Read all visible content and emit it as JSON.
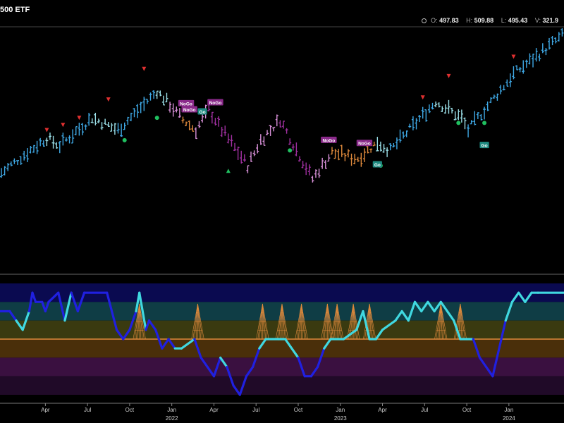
{
  "header": {
    "title": "500 ETF",
    "ohlc": [
      {
        "key": "O:",
        "value": "497.83"
      },
      {
        "key": "H:",
        "value": "509.88"
      },
      {
        "key": "L:",
        "value": "495.43"
      },
      {
        "key": "V:",
        "value": "321.9"
      }
    ]
  },
  "colors": {
    "strongUp": "#3fa9e6",
    "weakUp": "#9be0e8",
    "weakDown": "#e06060",
    "purple": "#a030a0",
    "pink": "#d890d8",
    "orange": "#e08a3c",
    "osc_strong": "#2020e0",
    "osc_weak": "#40d8e0",
    "zero_line": "#e08a3c",
    "marker_down": "#e03030",
    "marker_dot": "#20c060",
    "marker_up": "#20c060"
  },
  "x_axis": {
    "months": [
      {
        "label": "Apr",
        "week": 14
      },
      {
        "label": "Jul",
        "week": 27
      },
      {
        "label": "Oct",
        "week": 40
      },
      {
        "label": "Jan",
        "week": 53
      },
      {
        "label": "Apr",
        "week": 66
      },
      {
        "label": "Jul",
        "week": 79
      },
      {
        "label": "Oct",
        "week": 92
      },
      {
        "label": "Jan",
        "week": 105
      },
      {
        "label": "Apr",
        "week": 118
      },
      {
        "label": "Jul",
        "week": 131
      },
      {
        "label": "Oct",
        "week": 144
      },
      {
        "label": "Jan",
        "week": 157
      }
    ],
    "years": [
      {
        "label": "2022",
        "week": 53
      },
      {
        "label": "2023",
        "week": 105
      },
      {
        "label": "2024",
        "week": 157
      }
    ]
  },
  "chart_data": {
    "type": "bar",
    "price_range": [
      340,
      520
    ],
    "price_segments": [
      {
        "from": 0,
        "to": 8,
        "start": 378,
        "end": 398,
        "state": "strongUp"
      },
      {
        "from": 8,
        "to": 14,
        "start": 398,
        "end": 412,
        "state": "strongUp"
      },
      {
        "from": 14,
        "to": 18,
        "start": 412,
        "end": 405,
        "state": "weakUp"
      },
      {
        "from": 18,
        "to": 28,
        "start": 405,
        "end": 432,
        "state": "strongUp"
      },
      {
        "from": 28,
        "to": 36,
        "start": 432,
        "end": 420,
        "state": "weakUp"
      },
      {
        "from": 36,
        "to": 48,
        "start": 420,
        "end": 458,
        "state": "strongUp"
      },
      {
        "from": 48,
        "to": 52,
        "start": 458,
        "end": 445,
        "state": "weakUp"
      },
      {
        "from": 52,
        "to": 56,
        "start": 445,
        "end": 430,
        "state": "pink"
      },
      {
        "from": 56,
        "to": 60,
        "start": 430,
        "end": 420,
        "state": "orange"
      },
      {
        "from": 60,
        "to": 64,
        "start": 420,
        "end": 440,
        "state": "pink"
      },
      {
        "from": 64,
        "to": 68,
        "start": 440,
        "end": 420,
        "state": "purple"
      },
      {
        "from": 68,
        "to": 76,
        "start": 420,
        "end": 385,
        "state": "purple"
      },
      {
        "from": 76,
        "to": 80,
        "start": 385,
        "end": 410,
        "state": "pink"
      },
      {
        "from": 80,
        "to": 86,
        "start": 410,
        "end": 430,
        "state": "pink"
      },
      {
        "from": 86,
        "to": 92,
        "start": 430,
        "end": 395,
        "state": "purple"
      },
      {
        "from": 92,
        "to": 96,
        "start": 395,
        "end": 372,
        "state": "purple"
      },
      {
        "from": 96,
        "to": 102,
        "start": 372,
        "end": 398,
        "state": "pink"
      },
      {
        "from": 102,
        "to": 110,
        "start": 398,
        "end": 392,
        "state": "orange"
      },
      {
        "from": 110,
        "to": 116,
        "start": 392,
        "end": 408,
        "state": "orange"
      },
      {
        "from": 116,
        "to": 120,
        "start": 408,
        "end": 400,
        "state": "weakUp"
      },
      {
        "from": 120,
        "to": 134,
        "start": 400,
        "end": 448,
        "state": "strongUp"
      },
      {
        "from": 134,
        "to": 142,
        "start": 448,
        "end": 432,
        "state": "weakUp"
      },
      {
        "from": 142,
        "to": 144,
        "start": 432,
        "end": 420,
        "state": "weakUp"
      },
      {
        "from": 144,
        "to": 158,
        "start": 420,
        "end": 475,
        "state": "strongUp"
      },
      {
        "from": 158,
        "to": 174,
        "start": 475,
        "end": 515,
        "state": "strongUp"
      }
    ],
    "markers": [
      {
        "week": 14,
        "kind": "down",
        "price": 420
      },
      {
        "week": 19,
        "kind": "down",
        "price": 425
      },
      {
        "week": 24,
        "kind": "down",
        "price": 432
      },
      {
        "week": 33,
        "kind": "down",
        "price": 450
      },
      {
        "week": 44,
        "kind": "down",
        "price": 480
      },
      {
        "week": 38,
        "kind": "dot",
        "price": 410
      },
      {
        "week": 48,
        "kind": "dot",
        "price": 432
      },
      {
        "week": 70,
        "kind": "up",
        "price": 380
      },
      {
        "week": 89,
        "kind": "dot",
        "price": 400
      },
      {
        "week": 66,
        "kind": "dot",
        "price": 448
      },
      {
        "week": 117,
        "kind": "dot",
        "price": 385
      },
      {
        "week": 130,
        "kind": "down",
        "price": 452
      },
      {
        "week": 138,
        "kind": "down",
        "price": 473
      },
      {
        "week": 141,
        "kind": "dot",
        "price": 427
      },
      {
        "week": 149,
        "kind": "dot",
        "price": 427
      },
      {
        "week": 158,
        "kind": "down",
        "price": 492
      }
    ],
    "labels": [
      {
        "week": 57,
        "price": 446,
        "text": "NoGo",
        "kind": "nogo"
      },
      {
        "week": 58,
        "price": 440,
        "text": "NoGo",
        "kind": "nogo"
      },
      {
        "week": 62,
        "price": 438,
        "text": "Go",
        "kind": "go"
      },
      {
        "week": 66,
        "price": 447,
        "text": "NoGo",
        "kind": "nogo"
      },
      {
        "week": 101,
        "price": 410,
        "text": "NoGo",
        "kind": "nogo"
      },
      {
        "week": 112,
        "price": 407,
        "text": "NoGo",
        "kind": "nogo"
      },
      {
        "week": 116,
        "price": 386,
        "text": "Go",
        "kind": "go"
      },
      {
        "week": 149,
        "price": 405,
        "text": "Go",
        "kind": "go"
      }
    ],
    "oscillator": {
      "range": [
        -6,
        6
      ],
      "zones": [
        {
          "from": 6,
          "to": 4,
          "color": "#0a0a50"
        },
        {
          "from": 4,
          "to": 2,
          "color": "#0f3d45"
        },
        {
          "from": 2,
          "to": 0,
          "color": "#3a3a10"
        },
        {
          "from": 0,
          "to": -2,
          "color": "#4a2f0a"
        },
        {
          "from": -2,
          "to": -4,
          "color": "#3a1040"
        },
        {
          "from": -4,
          "to": -6,
          "color": "#200a28"
        }
      ],
      "points": [
        [
          0,
          3
        ],
        [
          3,
          3
        ],
        [
          5,
          2
        ],
        [
          7,
          1
        ],
        [
          9,
          3
        ],
        [
          10,
          5
        ],
        [
          11,
          4
        ],
        [
          13,
          4
        ],
        [
          14,
          3
        ],
        [
          15,
          4
        ],
        [
          18,
          5
        ],
        [
          20,
          2
        ],
        [
          22,
          5
        ],
        [
          24,
          3
        ],
        [
          26,
          5
        ],
        [
          33,
          5
        ],
        [
          36,
          1
        ],
        [
          38,
          0
        ],
        [
          40,
          1
        ],
        [
          42,
          3
        ],
        [
          43,
          5
        ],
        [
          45,
          1
        ],
        [
          46,
          2
        ],
        [
          48,
          1
        ],
        [
          50,
          -1
        ],
        [
          52,
          0
        ],
        [
          54,
          -1
        ],
        [
          56,
          -1
        ],
        [
          60,
          0
        ],
        [
          62,
          -2
        ],
        [
          64,
          -3
        ],
        [
          66,
          -4
        ],
        [
          68,
          -2
        ],
        [
          70,
          -3
        ],
        [
          72,
          -5
        ],
        [
          74,
          -6
        ],
        [
          76,
          -4
        ],
        [
          78,
          -3
        ],
        [
          80,
          -1
        ],
        [
          82,
          0
        ],
        [
          86,
          0
        ],
        [
          88,
          0
        ],
        [
          90,
          -1
        ],
        [
          92,
          -2
        ],
        [
          94,
          -4
        ],
        [
          96,
          -4
        ],
        [
          98,
          -3
        ],
        [
          100,
          -1
        ],
        [
          102,
          0
        ],
        [
          106,
          0
        ],
        [
          110,
          1
        ],
        [
          112,
          3
        ],
        [
          114,
          0
        ],
        [
          116,
          0
        ],
        [
          118,
          1
        ],
        [
          122,
          2
        ],
        [
          124,
          3
        ],
        [
          126,
          2
        ],
        [
          128,
          4
        ],
        [
          130,
          3
        ],
        [
          132,
          4
        ],
        [
          134,
          3
        ],
        [
          136,
          4
        ],
        [
          138,
          3
        ],
        [
          140,
          2
        ],
        [
          142,
          0
        ],
        [
          144,
          0
        ],
        [
          146,
          0
        ],
        [
          148,
          -2
        ],
        [
          150,
          -3
        ],
        [
          152,
          -4
        ],
        [
          154,
          -1
        ],
        [
          156,
          2
        ],
        [
          158,
          4
        ],
        [
          160,
          5
        ],
        [
          162,
          4
        ],
        [
          164,
          5
        ],
        [
          166,
          5
        ],
        [
          174,
          5
        ]
      ],
      "spikes": [
        43,
        61,
        81,
        87,
        93,
        101,
        104,
        109,
        114,
        136,
        142
      ]
    }
  }
}
